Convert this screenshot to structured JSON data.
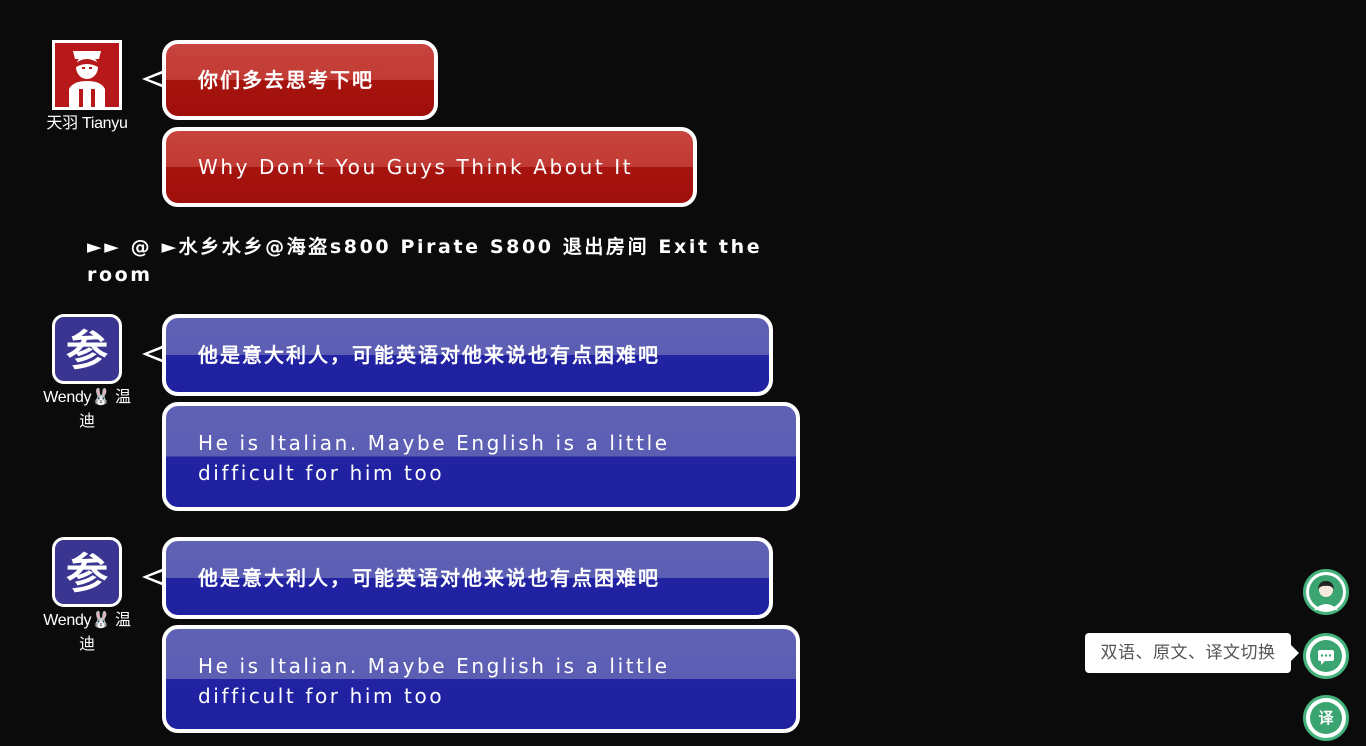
{
  "messages": [
    {
      "name": "天羽 Tianyu",
      "original": "你们多去思考下吧",
      "translation": "Why Don’t You Guys Think About It"
    },
    {
      "name": "Wendy🐰 温迪",
      "original": "他是意大利人，可能英语对他来说也有点困难吧",
      "translation": "He is Italian. Maybe English is a little difficult for him too"
    },
    {
      "name": "Wendy🐰 温迪",
      "original": "他是意大利人，可能英语对他来说也有点困难吧",
      "translation": "He is Italian. Maybe English is a little difficult for him too"
    }
  ],
  "system_message": "►► @ ►水乡水乡@海盗s800 Pirate S800 退出房间 Exit the room",
  "tools": {
    "tooltip": "双语、原文、译文切换",
    "translate_label": "译"
  },
  "colors": {
    "red_bubble": "#a00f0b",
    "blue_bubble": "#1f21a0",
    "tool_green": "#3aa571"
  }
}
